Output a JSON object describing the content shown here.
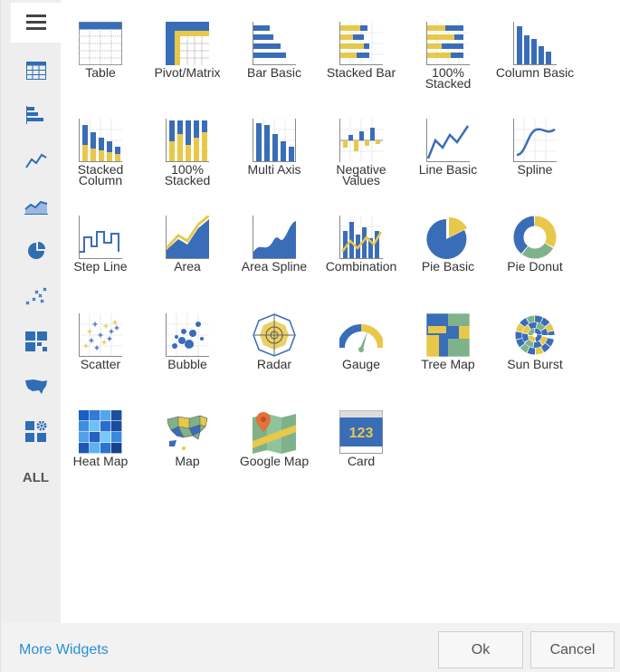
{
  "colors": {
    "blue": "#3a6db8",
    "yellow": "#e8c84a",
    "green": "#7fb28a",
    "link": "#2a8fd6",
    "sidebar_icon": "#2f6db5"
  },
  "sidebar": {
    "items": [
      {
        "icon": "hamburger-menu-icon"
      },
      {
        "icon": "table-icon"
      },
      {
        "icon": "bar-chart-icon"
      },
      {
        "icon": "line-chart-icon"
      },
      {
        "icon": "area-chart-icon"
      },
      {
        "icon": "pie-chart-icon"
      },
      {
        "icon": "scatter-icon"
      },
      {
        "icon": "treemap-icon"
      },
      {
        "icon": "us-map-icon"
      },
      {
        "icon": "widgets-gear-icon"
      }
    ],
    "all_label": "ALL"
  },
  "widgets": [
    {
      "label": "Table"
    },
    {
      "label": "Pivot/Matrix"
    },
    {
      "label": "Bar Basic"
    },
    {
      "label": "Stacked Bar"
    },
    {
      "label": "100% Stacked"
    },
    {
      "label": "Column Basic"
    },
    {
      "label": "Stacked Column"
    },
    {
      "label": "100% Stacked"
    },
    {
      "label": "Multi Axis"
    },
    {
      "label": "Negative Values"
    },
    {
      "label": "Line Basic"
    },
    {
      "label": "Spline"
    },
    {
      "label": "Step Line"
    },
    {
      "label": "Area"
    },
    {
      "label": "Area Spline"
    },
    {
      "label": "Combination"
    },
    {
      "label": "Pie Basic"
    },
    {
      "label": "Pie Donut"
    },
    {
      "label": "Scatter"
    },
    {
      "label": "Bubble"
    },
    {
      "label": "Radar"
    },
    {
      "label": "Gauge"
    },
    {
      "label": "Tree Map"
    },
    {
      "label": "Sun Burst"
    },
    {
      "label": "Heat Map"
    },
    {
      "label": "Map"
    },
    {
      "label": "Google Map"
    },
    {
      "label": "Card",
      "card_value": "123"
    }
  ],
  "footer": {
    "more_widgets": "More Widgets",
    "ok": "Ok",
    "cancel": "Cancel"
  }
}
